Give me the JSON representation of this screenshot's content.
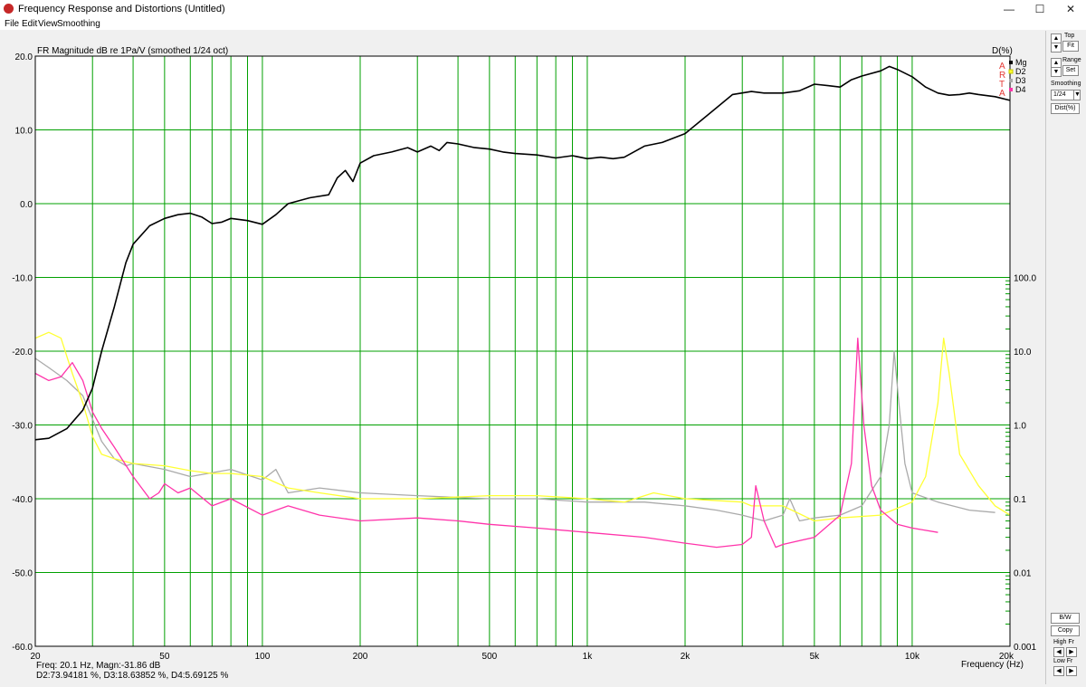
{
  "window": {
    "title": "Frequency Response and Distortions (Untitled)",
    "minimize": "—",
    "maximize": "☐",
    "close": "✕"
  },
  "menu": [
    "File",
    "Edit",
    "View",
    "Smoothing"
  ],
  "colors": {
    "plot_bg": "#ffffff",
    "grid": "#00a000",
    "Mg": "#000000",
    "D2": "#ffff33",
    "D3": "#aaaaaa",
    "D4": "#ff33aa"
  },
  "chart_data": {
    "type": "line",
    "title": "FR Magnitude dB re 1Pa/V (smoothed 1/24 oct)",
    "right_axis_title": "D(%)",
    "xlabel": "Frequency (Hz)",
    "x_scale": "log",
    "xlim": [
      20,
      20000
    ],
    "x_ticks": [
      {
        "v": 20,
        "label": "20"
      },
      {
        "v": 50,
        "label": "50"
      },
      {
        "v": 100,
        "label": "100"
      },
      {
        "v": 200,
        "label": "200"
      },
      {
        "v": 500,
        "label": "500"
      },
      {
        "v": 1000,
        "label": "1k"
      },
      {
        "v": 2000,
        "label": "2k"
      },
      {
        "v": 5000,
        "label": "5k"
      },
      {
        "v": 10000,
        "label": "10k"
      },
      {
        "v": 20000,
        "label": "20k"
      }
    ],
    "ylim": [
      -60,
      20
    ],
    "y_ticks": [
      "20.0",
      "10.0",
      "0.0",
      "-10.0",
      "-20.0",
      "-30.0",
      "-40.0",
      "-50.0",
      "-60.0"
    ],
    "right_scale": "log",
    "right_lim": [
      0.001,
      100
    ],
    "right_ticks": [
      "100.0",
      "10.0",
      "1.0",
      "0.1",
      "0.01",
      "0.001"
    ],
    "grid": true,
    "legend_position": "top-right",
    "watermark": [
      "A",
      "R",
      "T",
      "A"
    ],
    "series": [
      {
        "name": "Mg",
        "axis": "left",
        "color": "#000000",
        "points": [
          [
            20,
            -32
          ],
          [
            22,
            -31.8
          ],
          [
            25,
            -30.5
          ],
          [
            28,
            -28
          ],
          [
            30,
            -25
          ],
          [
            32,
            -20
          ],
          [
            35,
            -14
          ],
          [
            38,
            -8
          ],
          [
            40,
            -5.5
          ],
          [
            45,
            -3
          ],
          [
            50,
            -2
          ],
          [
            55,
            -1.5
          ],
          [
            60,
            -1.3
          ],
          [
            65,
            -1.8
          ],
          [
            70,
            -2.7
          ],
          [
            75,
            -2.5
          ],
          [
            80,
            -2
          ],
          [
            90,
            -2.3
          ],
          [
            100,
            -2.8
          ],
          [
            110,
            -1.5
          ],
          [
            120,
            0
          ],
          [
            140,
            0.8
          ],
          [
            160,
            1.2
          ],
          [
            170,
            3.5
          ],
          [
            180,
            4.5
          ],
          [
            190,
            3
          ],
          [
            200,
            5.5
          ],
          [
            220,
            6.5
          ],
          [
            250,
            7
          ],
          [
            280,
            7.6
          ],
          [
            300,
            7
          ],
          [
            330,
            7.8
          ],
          [
            350,
            7.2
          ],
          [
            370,
            8.3
          ],
          [
            400,
            8.1
          ],
          [
            450,
            7.6
          ],
          [
            500,
            7.4
          ],
          [
            550,
            7
          ],
          [
            600,
            6.8
          ],
          [
            700,
            6.6
          ],
          [
            800,
            6.2
          ],
          [
            900,
            6.5
          ],
          [
            1000,
            6.1
          ],
          [
            1100,
            6.3
          ],
          [
            1200,
            6.1
          ],
          [
            1300,
            6.3
          ],
          [
            1500,
            7.8
          ],
          [
            1700,
            8.3
          ],
          [
            2000,
            9.5
          ],
          [
            2200,
            11
          ],
          [
            2500,
            13
          ],
          [
            2800,
            14.8
          ],
          [
            3200,
            15.2
          ],
          [
            3500,
            15
          ],
          [
            4000,
            15
          ],
          [
            4500,
            15.3
          ],
          [
            5000,
            16.2
          ],
          [
            5500,
            16
          ],
          [
            6000,
            15.8
          ],
          [
            6500,
            16.8
          ],
          [
            7000,
            17.3
          ],
          [
            8000,
            18
          ],
          [
            8500,
            18.6
          ],
          [
            9000,
            18.2
          ],
          [
            10000,
            17.2
          ],
          [
            11000,
            15.8
          ],
          [
            12000,
            15
          ],
          [
            13000,
            14.7
          ],
          [
            14000,
            14.8
          ],
          [
            15000,
            15
          ],
          [
            16000,
            14.8
          ],
          [
            18000,
            14.5
          ],
          [
            20000,
            14
          ]
        ]
      },
      {
        "name": "D2",
        "axis": "right",
        "color": "#ffff33",
        "points": [
          [
            20,
            15
          ],
          [
            22,
            18
          ],
          [
            24,
            15
          ],
          [
            26,
            5
          ],
          [
            28,
            2
          ],
          [
            30,
            0.7
          ],
          [
            32,
            0.4
          ],
          [
            35,
            0.35
          ],
          [
            40,
            0.3
          ],
          [
            50,
            0.28
          ],
          [
            60,
            0.24
          ],
          [
            70,
            0.22
          ],
          [
            80,
            0.22
          ],
          [
            100,
            0.2
          ],
          [
            120,
            0.14
          ],
          [
            150,
            0.12
          ],
          [
            200,
            0.1
          ],
          [
            300,
            0.1
          ],
          [
            500,
            0.11
          ],
          [
            700,
            0.11
          ],
          [
            1000,
            0.1
          ],
          [
            1300,
            0.09
          ],
          [
            1600,
            0.12
          ],
          [
            2000,
            0.1
          ],
          [
            3000,
            0.09
          ],
          [
            3200,
            0.08
          ],
          [
            4000,
            0.08
          ],
          [
            5000,
            0.05
          ],
          [
            6000,
            0.055
          ],
          [
            8000,
            0.06
          ],
          [
            10000,
            0.09
          ],
          [
            11000,
            0.2
          ],
          [
            12000,
            2
          ],
          [
            12500,
            15
          ],
          [
            13000,
            5
          ],
          [
            14000,
            0.4
          ],
          [
            16000,
            0.15
          ],
          [
            18000,
            0.08
          ],
          [
            20000,
            0.06
          ]
        ]
      },
      {
        "name": "D3",
        "axis": "right",
        "color": "#aaaaaa",
        "points": [
          [
            20,
            8
          ],
          [
            22,
            6
          ],
          [
            25,
            4
          ],
          [
            28,
            2.5
          ],
          [
            30,
            1.2
          ],
          [
            32,
            0.6
          ],
          [
            35,
            0.35
          ],
          [
            38,
            0.28
          ],
          [
            40,
            0.3
          ],
          [
            50,
            0.25
          ],
          [
            60,
            0.2
          ],
          [
            80,
            0.25
          ],
          [
            100,
            0.18
          ],
          [
            110,
            0.25
          ],
          [
            120,
            0.12
          ],
          [
            150,
            0.14
          ],
          [
            200,
            0.12
          ],
          [
            300,
            0.11
          ],
          [
            500,
            0.1
          ],
          [
            700,
            0.1
          ],
          [
            1000,
            0.09
          ],
          [
            1500,
            0.09
          ],
          [
            2000,
            0.08
          ],
          [
            2500,
            0.07
          ],
          [
            3000,
            0.06
          ],
          [
            3500,
            0.05
          ],
          [
            4000,
            0.06
          ],
          [
            4200,
            0.1
          ],
          [
            4500,
            0.05
          ],
          [
            5000,
            0.055
          ],
          [
            6000,
            0.06
          ],
          [
            7000,
            0.08
          ],
          [
            8000,
            0.2
          ],
          [
            8500,
            1
          ],
          [
            8800,
            10
          ],
          [
            9100,
            2
          ],
          [
            9500,
            0.3
          ],
          [
            10000,
            0.12
          ],
          [
            12000,
            0.09
          ],
          [
            15000,
            0.07
          ],
          [
            18000,
            0.065
          ]
        ]
      },
      {
        "name": "D4",
        "axis": "right",
        "color": "#ff33aa",
        "points": [
          [
            20,
            5
          ],
          [
            22,
            4
          ],
          [
            24,
            4.5
          ],
          [
            26,
            7
          ],
          [
            28,
            4
          ],
          [
            30,
            1.5
          ],
          [
            32,
            0.9
          ],
          [
            35,
            0.5
          ],
          [
            40,
            0.2
          ],
          [
            45,
            0.1
          ],
          [
            48,
            0.12
          ],
          [
            50,
            0.16
          ],
          [
            55,
            0.12
          ],
          [
            60,
            0.14
          ],
          [
            70,
            0.08
          ],
          [
            80,
            0.1
          ],
          [
            100,
            0.06
          ],
          [
            120,
            0.08
          ],
          [
            150,
            0.06
          ],
          [
            200,
            0.05
          ],
          [
            300,
            0.055
          ],
          [
            400,
            0.05
          ],
          [
            500,
            0.045
          ],
          [
            700,
            0.04
          ],
          [
            1000,
            0.035
          ],
          [
            1500,
            0.03
          ],
          [
            2000,
            0.025
          ],
          [
            2500,
            0.022
          ],
          [
            3000,
            0.024
          ],
          [
            3200,
            0.03
          ],
          [
            3300,
            0.15
          ],
          [
            3500,
            0.05
          ],
          [
            3800,
            0.022
          ],
          [
            4000,
            0.024
          ],
          [
            5000,
            0.03
          ],
          [
            6000,
            0.06
          ],
          [
            6500,
            0.3
          ],
          [
            6800,
            15
          ],
          [
            7100,
            1
          ],
          [
            7500,
            0.15
          ],
          [
            8000,
            0.07
          ],
          [
            9000,
            0.045
          ],
          [
            10000,
            0.04
          ],
          [
            12000,
            0.035
          ]
        ]
      }
    ]
  },
  "right_panel": {
    "top_label": "Top",
    "fit_label": "Fit",
    "range_label": "Range",
    "set_label": "Set",
    "smoothing_label": "Smoothing",
    "smoothing_value": "1/24",
    "dist_label": "Dist(%)",
    "bw_label": "B/W",
    "copy_label": "Copy",
    "high_fr_label": "High Fr",
    "low_fr_label": "Low Fr",
    "arrow_up": "▲",
    "arrow_down": "▼",
    "arrow_left": "◀",
    "arrow_right": "▶"
  },
  "status": {
    "line1": "Freq: 20.1 Hz, Magn:-31.86 dB",
    "line2": "D2:73.94181 %, D3:18.63852 %, D4:5.69125 %"
  }
}
